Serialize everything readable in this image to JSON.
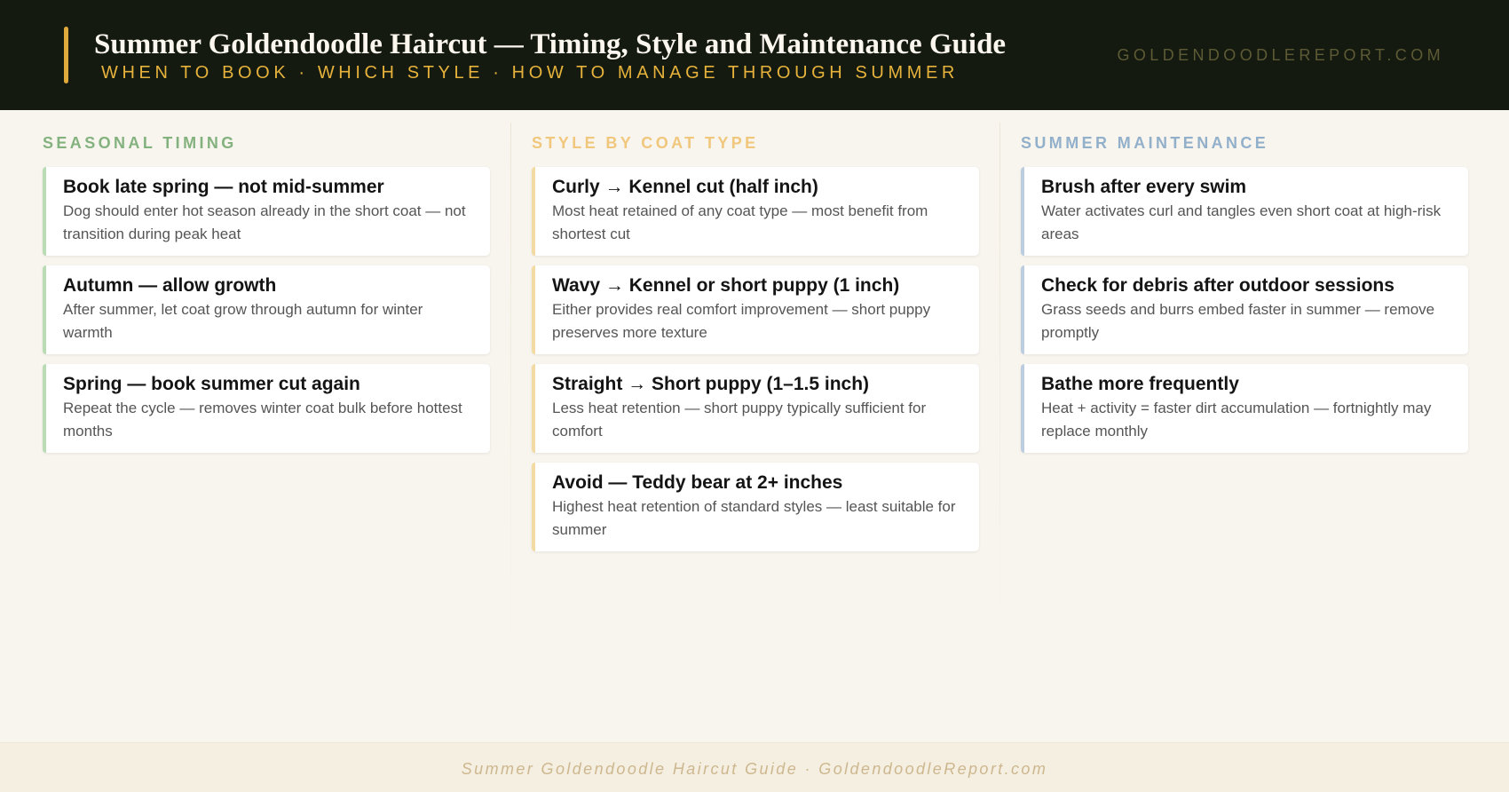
{
  "header": {
    "title": "Summer Goldendoodle Haircut — Timing, Style and Maintenance Guide",
    "subtitle": "WHEN TO BOOK · WHICH STYLE · HOW TO MANAGE THROUGH SUMMER",
    "site": "GOLDENDOODLEREPORT.COM"
  },
  "colors": {
    "header_bg": "#141a0f",
    "accent_gold": "#e0a93b",
    "timing_green": "#84b27f",
    "style_gold": "#f0c77c",
    "maintenance_blue": "#93b0cb"
  },
  "columns": [
    {
      "heading": "SEASONAL TIMING",
      "cards": [
        {
          "title": "Book late spring — not mid-summer",
          "desc": "Dog should enter hot season already in the short coat — not transition during peak heat"
        },
        {
          "title": "Autumn — allow growth",
          "desc": "After summer, let coat grow through autumn for winter warmth"
        },
        {
          "title": "Spring — book summer cut again",
          "desc": "Repeat the cycle — removes winter coat bulk before hottest months"
        }
      ]
    },
    {
      "heading": "STYLE BY COAT TYPE",
      "cards": [
        {
          "title": "Curly → Kennel cut (half inch)",
          "desc": "Most heat retained of any coat type — most benefit from shortest cut"
        },
        {
          "title": "Wavy → Kennel or short puppy (1 inch)",
          "desc": "Either provides real comfort improvement — short puppy preserves more texture"
        },
        {
          "title": "Straight → Short puppy (1–1.5 inch)",
          "desc": "Less heat retention — short puppy typically sufficient for comfort"
        },
        {
          "title": "Avoid — Teddy bear at 2+ inches",
          "desc": "Highest heat retention of standard styles — least suitable for summer"
        }
      ]
    },
    {
      "heading": "SUMMER MAINTENANCE",
      "cards": [
        {
          "title": "Brush after every swim",
          "desc": "Water activates curl and tangles even short coat at high-risk areas"
        },
        {
          "title": "Check for debris after outdoor sessions",
          "desc": "Grass seeds and burrs embed faster in summer — remove promptly"
        },
        {
          "title": "Bathe more frequently",
          "desc": "Heat + activity = faster dirt accumulation — fortnightly may replace monthly"
        }
      ]
    }
  ],
  "footer": {
    "text": "Summer Goldendoodle Haircut Guide · GoldendoodleReport.com"
  }
}
